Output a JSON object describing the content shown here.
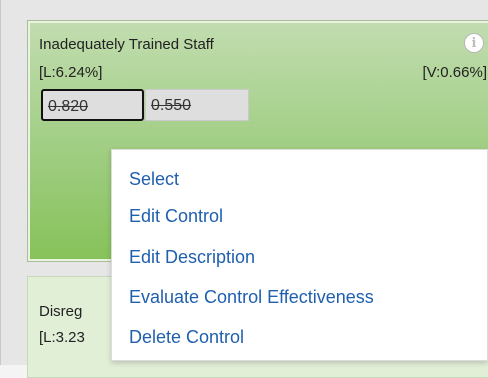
{
  "card": {
    "title": "Inadequately Trained Staff",
    "stat_l": "[L:6.24%]",
    "stat_v": "[V:0.66%]",
    "value_1": "0.820",
    "value_2": "0.550",
    "info_glyph": "i"
  },
  "card2": {
    "title": "Disreg",
    "stat": "[L:3.23"
  },
  "menu": {
    "items": [
      "Select",
      "Edit Control",
      "Edit Description",
      "Evaluate Control Effectiveness",
      "Delete Control"
    ]
  },
  "colors": {
    "card_green": "#86c259",
    "menu_link": "#1f5fae"
  }
}
